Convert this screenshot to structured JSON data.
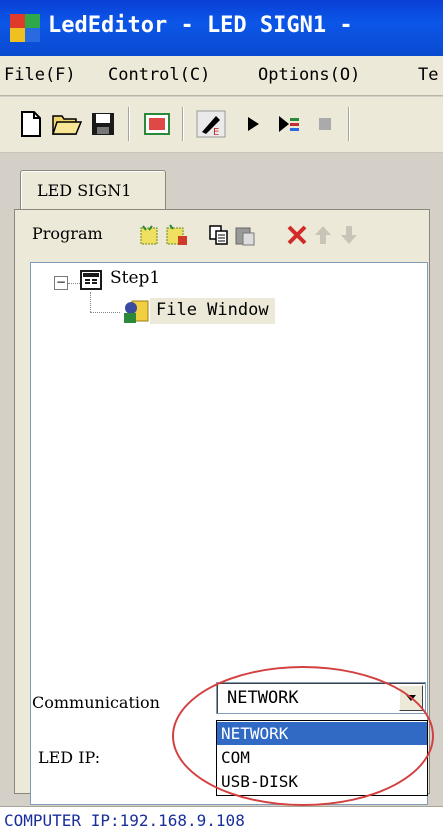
{
  "window": {
    "title": "LedEditor - LED SIGN1 -",
    "app_icon": "led-editor-app-icon",
    "accent_colors": {
      "titlebar": "#0b56e8",
      "selection": "#316ac5",
      "annotation": "#d24040"
    }
  },
  "menubar": {
    "items": [
      {
        "label": "File(F)"
      },
      {
        "label": "Control(C)"
      },
      {
        "label": "Options(O)"
      },
      {
        "label": "Te"
      }
    ]
  },
  "toolbar": {
    "buttons": [
      {
        "icon": "new-document-icon"
      },
      {
        "icon": "open-folder-icon"
      },
      {
        "icon": "save-disk-icon"
      },
      {
        "icon": "led-screen-icon"
      },
      {
        "icon": "edit-pen-icon"
      },
      {
        "icon": "play-icon"
      },
      {
        "icon": "step-play-icon"
      },
      {
        "icon": "stop-icon"
      }
    ]
  },
  "tabs": [
    {
      "label": "LED SIGN1",
      "active": true
    }
  ],
  "program_bar": {
    "label": "Program",
    "buttons": [
      {
        "icon": "new-program-icon"
      },
      {
        "icon": "new-file-window-icon"
      },
      {
        "icon": "copy-icon"
      },
      {
        "icon": "paste-icon"
      },
      {
        "icon": "delete-icon"
      },
      {
        "icon": "move-up-icon"
      },
      {
        "icon": "move-down-icon"
      }
    ]
  },
  "tree": {
    "root": {
      "label": "Step1",
      "expander": "−",
      "icon": "step-icon"
    },
    "child": {
      "label": "File Window",
      "icon": "file-window-icon",
      "selected": true
    }
  },
  "communication": {
    "label": "Communication",
    "selected": "NETWORK",
    "options": [
      {
        "label": "NETWORK",
        "highlighted": true
      },
      {
        "label": "COM",
        "highlighted": false
      },
      {
        "label": "USB-DISK",
        "highlighted": false
      }
    ]
  },
  "led_ip": {
    "label": "LED IP:"
  },
  "status": {
    "text": "COMPUTER IP:192.168.9.108"
  }
}
